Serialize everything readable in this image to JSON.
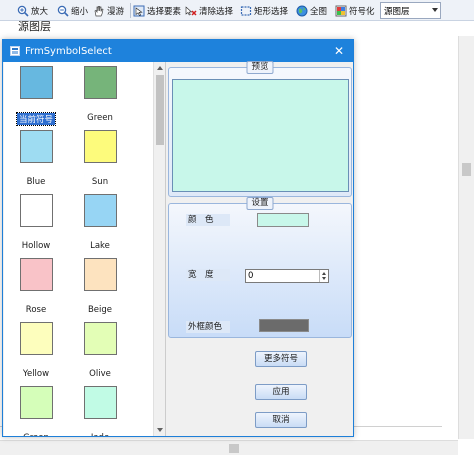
{
  "toolbar": {
    "zoom_in": "放大",
    "zoom_out": "缩小",
    "pan": "漫游",
    "select_features": "选择要素",
    "clear_selection": "清除选择",
    "rect_select": "矩形选择",
    "full_extent": "全图",
    "symbolize": "符号化",
    "layer_combo_value": "源图层"
  },
  "background": {
    "layer_header": "源图层"
  },
  "dialog": {
    "title": "FrmSymbolSelect",
    "close_glyph": "✕",
    "symbols": [
      {
        "name": "当前符号",
        "color": "#67b8e0",
        "selected": true
      },
      {
        "name": "Green",
        "color": "#76b47a",
        "selected": false
      },
      {
        "name": "Blue",
        "color": "#9edcf2",
        "selected": false
      },
      {
        "name": "Sun",
        "color": "#fdfb7c",
        "selected": false
      },
      {
        "name": "Hollow",
        "color": "#ffffff",
        "selected": false
      },
      {
        "name": "Lake",
        "color": "#97d5f4",
        "selected": false
      },
      {
        "name": "Rose",
        "color": "#f9c3c8",
        "selected": false
      },
      {
        "name": "Beige",
        "color": "#fde3bf",
        "selected": false
      },
      {
        "name": "Yellow",
        "color": "#fdfebd",
        "selected": false
      },
      {
        "name": "Olive",
        "color": "#e3feb6",
        "selected": false
      },
      {
        "name": "Green",
        "color": "#d5feb9",
        "selected": false
      },
      {
        "name": "Jade",
        "color": "#c1fbe5",
        "selected": false
      }
    ],
    "preview": {
      "legend": "预览",
      "fill_color": "#c8f7ea"
    },
    "settings": {
      "legend": "设置",
      "color_label": "颜　色",
      "fill_color": "#c8f7ea",
      "width_label": "宽　度",
      "width_value": "0",
      "outline_label": "外框颜色",
      "outline_color": "#6b6b6b"
    },
    "buttons": {
      "more_symbols": "更多符号",
      "apply": "应用",
      "cancel": "取消"
    }
  },
  "colors": {
    "titlebar": "#1e82dc",
    "accent_select": "#2f6fd0"
  }
}
